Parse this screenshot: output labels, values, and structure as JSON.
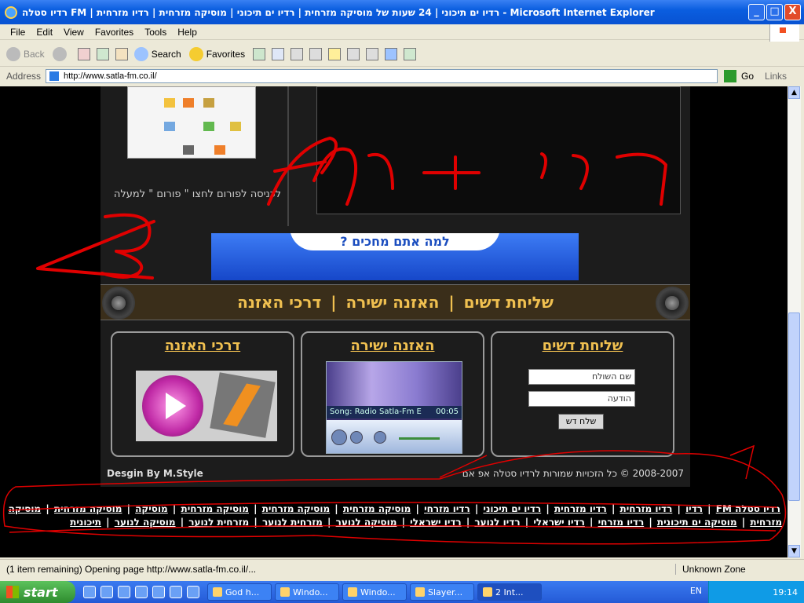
{
  "window": {
    "title": "רדיו סטלה FM | רדיו ים תיכוני | 24 שעות של מוסיקה מזרחית | רדיו ים תיכוני | מוסיקה מזרחית | רדיו מזרחית - Microsoft Internet Explorer",
    "controls": [
      "_",
      "□",
      "X"
    ]
  },
  "menu": [
    "File",
    "Edit",
    "View",
    "Favorites",
    "Tools",
    "Help"
  ],
  "toolbar": {
    "back_label": "Back",
    "search_label": "Search",
    "favorites_label": "Favorites"
  },
  "address": {
    "label": "Address",
    "url": "http://www.satla-fm.co.il/",
    "go_label": "Go",
    "links_label": "Links"
  },
  "page": {
    "forum_text": "לכניסה לפורום לחצו \" פורום \" למעלה",
    "banner_text": "למה אתם מחכים ?",
    "nav": [
      "שליחת דשים",
      "האזנה ישירה",
      "דרכי האזנה"
    ],
    "panels": {
      "greetings": {
        "title": "שליחת דשים",
        "sender_placeholder": "שם השולח",
        "message_placeholder": "הודעה",
        "send_label": "שלח דש"
      },
      "live": {
        "title": "האזנה ישירה",
        "song": "Song: Radio Satla-Fm E",
        "time": "00:05"
      },
      "ways": {
        "title": "דרכי האזנה"
      }
    },
    "credit": "Desgin By M.Style",
    "copyright": "2008-2007 © כל הזכויות שמורות לרדיו סטלה אפ אם"
  },
  "footer_links": [
    "רדיו סטלה FM",
    "רדיו",
    "רדיו מזרחית",
    "רדיו מזרחית",
    "רדיו ים תיכוני",
    "רדיו מזרחי",
    "מוסיקה מזרחית",
    "מוסיקה מזרחית",
    "מוסיקה מזרחית",
    "מוסיקה",
    "מוסיקה מזרחית",
    "מוסיקה מזרחית",
    "מוסיקה ים תיכונית",
    "רדיו מזרחי",
    "רדיו ישראלי",
    "רדיו לנוער",
    "רדיו ישראלי",
    "מוסיקה לנוער",
    "מזרחית לנוער",
    "מזרחית לנוער",
    "מוסיקה לנוער",
    "תיכונית"
  ],
  "status": {
    "message": "(1 item remaining) Opening page http://www.satla-fm.co.il/...",
    "zone": "Unknown Zone"
  },
  "taskbar": {
    "start_label": "start",
    "tasks": [
      "God h...",
      "Windo...",
      "Windo...",
      "Slayer...",
      "2 Int..."
    ],
    "language": "EN",
    "clock": "19:14"
  }
}
